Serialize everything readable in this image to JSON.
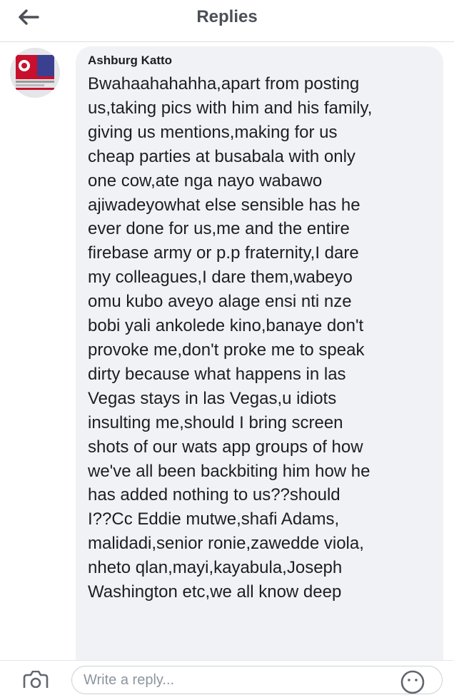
{
  "header": {
    "title": "Replies",
    "back_icon": "arrow-left-icon"
  },
  "comment": {
    "author": "Ashburg Katto",
    "avatar_icon": "profile-picture",
    "lines": [
      "Bwahaahahahha,apart from posting",
      "us,taking pics with him and his family,",
      "giving us mentions,making for us",
      "cheap parties at busabala with only",
      "one cow,ate nga nayo wabawo",
      "ajiwadeyowhat else sensible has he",
      "ever done for us,me and the entire",
      "firebase army or p.p fraternity,I dare",
      "my colleagues,I dare them,wabeyo",
      "omu kubo aveyo alage ensi nti nze",
      "bobi yali ankolede kino,banaye don't",
      "provoke me,don't proke me to speak",
      "dirty because what happens in las",
      "Vegas stays in las Vegas,u idiots",
      "insulting me,should I bring screen",
      "shots of our wats app groups of how",
      "we've all been backbiting him how he",
      "has added nothing to us??should",
      "I??Cc Eddie mutwe,shafi Adams,",
      "malidadi,senior ronie,zawedde viola,",
      "nheto qlan,mayi,kayabula,Joseph",
      "Washington etc,we all know deep"
    ]
  },
  "composer": {
    "placeholder": "Write a reply...",
    "camera_icon": "camera-icon",
    "emoji_icon": "emoji-icon"
  },
  "colors": {
    "bubble_bg": "#f0f2f5",
    "text": "#1c1e21",
    "header_text": "#4b4f56",
    "avatar_red": "#c8102e"
  }
}
